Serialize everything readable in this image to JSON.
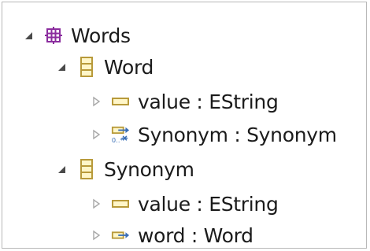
{
  "tree": {
    "root": {
      "label": "Words",
      "icon": "package-icon",
      "expanded": true,
      "children": [
        {
          "label": "Word",
          "icon": "class-icon",
          "expanded": true,
          "children": [
            {
              "label": "value : EString",
              "icon": "attribute-icon",
              "expanded": false
            },
            {
              "label": "Synonym : Synonym",
              "icon": "reference-many-icon",
              "multiplicity": "0..*",
              "expanded": false
            }
          ]
        },
        {
          "label": "Synonym",
          "icon": "class-icon",
          "expanded": true,
          "children": [
            {
              "label": "value : EString",
              "icon": "attribute-icon",
              "expanded": false
            },
            {
              "label": "word : Word",
              "icon": "reference-icon",
              "expanded": false
            }
          ]
        }
      ]
    }
  },
  "colors": {
    "package": "#8b2d9e",
    "class": "#b89a3a",
    "class_fill": "#fff6c8",
    "attribute": "#b89a3a",
    "reference": "#b89a3a",
    "reference_arrow": "#3b6fb6",
    "expanded_toggle": "#4a4a4a",
    "collapsed_toggle": "#a8a8a8"
  }
}
